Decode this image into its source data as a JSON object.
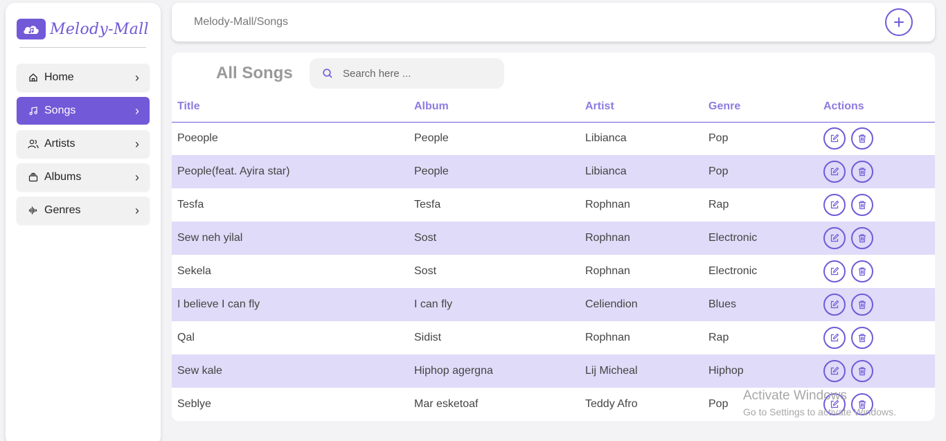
{
  "app": {
    "logo_text": "Melody-Mall",
    "brand_color": "#7159d8",
    "row_highlight": "#dfdbf8"
  },
  "header": {
    "breadcrumb": "Melody-Mall/Songs",
    "add_icon": "plus-icon"
  },
  "sidebar": {
    "items": [
      {
        "label": "Home",
        "icon": "home-icon",
        "active": false
      },
      {
        "label": "Songs",
        "icon": "music-note-icon",
        "active": true
      },
      {
        "label": "Artists",
        "icon": "users-icon",
        "active": false
      },
      {
        "label": "Albums",
        "icon": "album-icon",
        "active": false
      },
      {
        "label": "Genres",
        "icon": "waveform-icon",
        "active": false
      }
    ]
  },
  "main": {
    "title": "All Songs",
    "search": {
      "placeholder": "Search here ...",
      "value": ""
    },
    "columns": [
      "Title",
      "Album",
      "Artist",
      "Genre",
      "Actions"
    ],
    "rows": [
      {
        "title": "Poeople",
        "album": "People",
        "artist": "Libianca",
        "genre": "Pop"
      },
      {
        "title": "People(feat. Ayira star)",
        "album": "People",
        "artist": "Libianca",
        "genre": "Pop"
      },
      {
        "title": "Tesfa",
        "album": "Tesfa",
        "artist": "Rophnan",
        "genre": "Rap"
      },
      {
        "title": "Sew neh yilal",
        "album": "Sost",
        "artist": "Rophnan",
        "genre": "Electronic"
      },
      {
        "title": "Sekela",
        "album": "Sost",
        "artist": "Rophnan",
        "genre": "Electronic"
      },
      {
        "title": "I believe I can fly",
        "album": "I can fly",
        "artist": "Celiendion",
        "genre": "Blues"
      },
      {
        "title": "Qal",
        "album": "Sidist",
        "artist": "Rophnan",
        "genre": "Rap"
      },
      {
        "title": "Sew kale",
        "album": "Hiphop agergna",
        "artist": "Lij Micheal",
        "genre": "Hiphop"
      },
      {
        "title": "Seblye",
        "album": "Mar esketoaf",
        "artist": "Teddy Afro",
        "genre": "Pop"
      }
    ]
  },
  "watermark": {
    "line1": "Activate Windows",
    "line2": "Go to Settings to activate Windows."
  }
}
